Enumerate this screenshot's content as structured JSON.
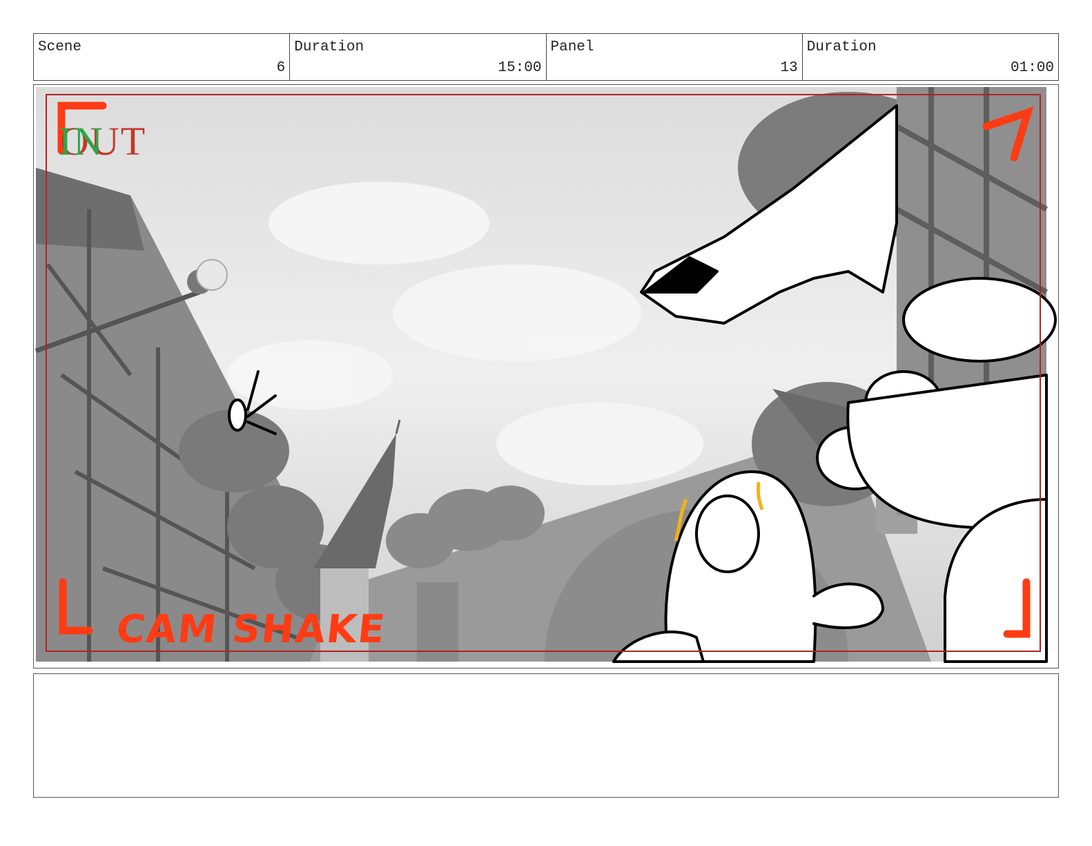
{
  "header": {
    "scene_label": "Scene",
    "scene_value": "6",
    "duration_label": "Duration",
    "duration_value": "15:00",
    "panel_label": "Panel",
    "panel_value": "13",
    "panel_duration_label": "Duration",
    "panel_duration_value": "01:00"
  },
  "frame": {
    "in_label": "IN",
    "out_label": "OUT",
    "annotation": "CAM SHAKE",
    "annotation_color": "#ff3b14",
    "safe_frame_color": "#b22222",
    "in_color": "#2aa84a",
    "out_color": "#c0392b"
  },
  "notes": {
    "text": ""
  }
}
